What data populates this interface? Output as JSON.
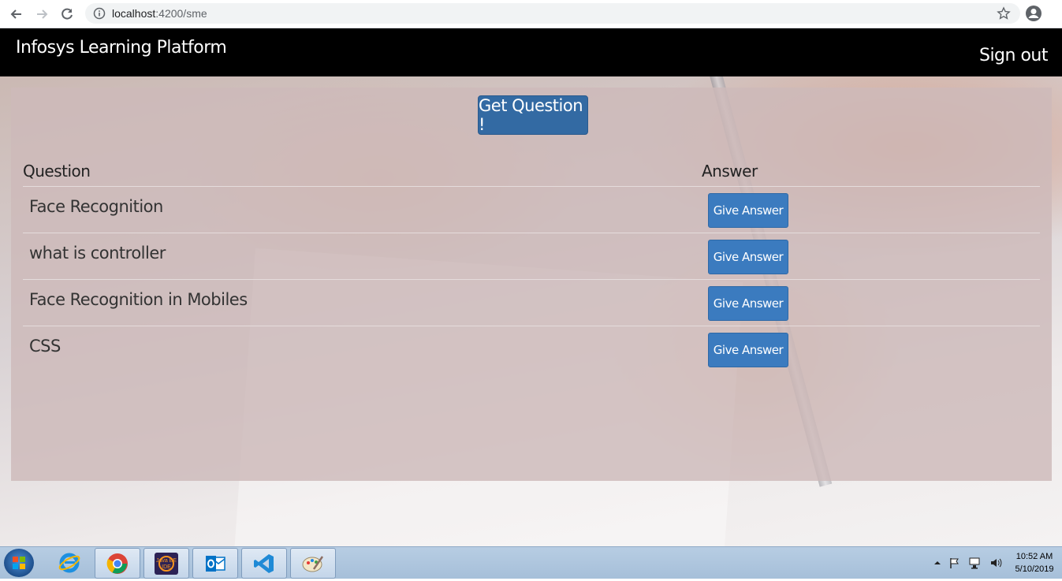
{
  "browser": {
    "url_host": "localhost",
    "url_path": ":4200/sme"
  },
  "navbar": {
    "brand": "Infosys Learning Platform",
    "signout_label": "Sign out"
  },
  "panel": {
    "get_question_label": "Get Question !",
    "headers": {
      "question": "Question",
      "answer": "Answer"
    },
    "rows": [
      {
        "question": "Face Recognition",
        "action": "Give Answer"
      },
      {
        "question": "what is controller",
        "action": "Give Answer"
      },
      {
        "question": "Face Recognition in Mobiles",
        "action": "Give Answer"
      },
      {
        "question": "CSS",
        "action": "Give Answer"
      }
    ]
  },
  "taskbar": {
    "icons": [
      "windows-start-icon",
      "internet-explorer-icon",
      "chrome-icon",
      "java-ee-ide-icon",
      "outlook-icon",
      "vscode-icon",
      "paint-icon"
    ],
    "java_ide_label": "Java EE IDE",
    "clock_time": "10:52 AM",
    "clock_date": "5/10/2019"
  },
  "colors": {
    "navbar": "#000000",
    "primary_button": "#336aa3",
    "answer_button": "#3b7bbf",
    "panel_overlay": "#cdb9b9"
  }
}
